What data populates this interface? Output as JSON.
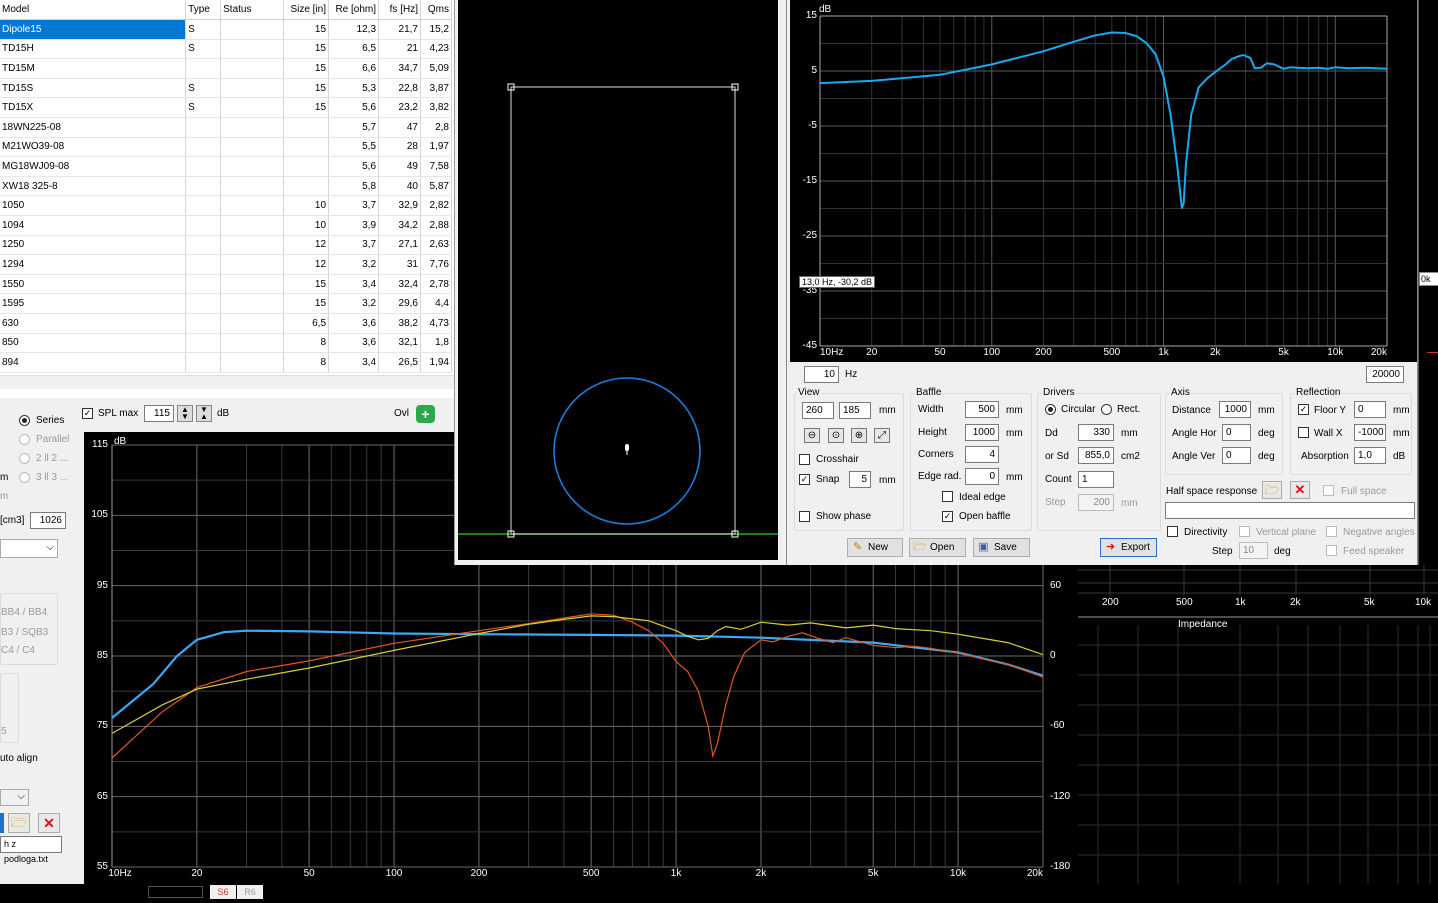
{
  "driver_table": {
    "columns": [
      "Model",
      "Type",
      "Status",
      "Size [in]",
      "Re [ohm]",
      "fs [Hz]",
      "Qms"
    ],
    "rows": [
      [
        "Dipole15",
        "S",
        "",
        "15",
        "12,3",
        "21,7",
        "15,2"
      ],
      [
        "TD15H",
        "S",
        "",
        "15",
        "6,5",
        "21",
        "4,23"
      ],
      [
        "TD15M",
        "",
        "",
        "15",
        "6,6",
        "34,7",
        "5,09"
      ],
      [
        "TD15S",
        "S",
        "",
        "15",
        "5,3",
        "22,8",
        "3,87"
      ],
      [
        "TD15X",
        "S",
        "",
        "15",
        "5,6",
        "23,2",
        "3,82"
      ],
      [
        "18WN225-08",
        "",
        "",
        "",
        "5,7",
        "47",
        "2,8"
      ],
      [
        "M21WO39-08",
        "",
        "",
        "",
        "5,5",
        "28",
        "1,97"
      ],
      [
        "MG18WJ09-08",
        "",
        "",
        "",
        "5,6",
        "49",
        "7,58"
      ],
      [
        "XW18 325-8",
        "",
        "",
        "",
        "5,8",
        "40",
        "5,87"
      ],
      [
        "1050",
        "",
        "",
        "10",
        "3,7",
        "32,9",
        "2,82"
      ],
      [
        "1094",
        "",
        "",
        "10",
        "3,9",
        "34,2",
        "2,88"
      ],
      [
        "1250",
        "",
        "",
        "12",
        "3,7",
        "27,1",
        "2,63"
      ],
      [
        "1294",
        "",
        "",
        "12",
        "3,2",
        "31",
        "7,76"
      ],
      [
        "1550",
        "",
        "",
        "15",
        "3,4",
        "32,4",
        "2,78"
      ],
      [
        "1595",
        "",
        "",
        "15",
        "3,2",
        "29,6",
        "4,4"
      ],
      [
        "630",
        "",
        "",
        "6,5",
        "3,6",
        "38,2",
        "4,73"
      ],
      [
        "850",
        "",
        "",
        "8",
        "3,6",
        "32,1",
        "1,8"
      ],
      [
        "894",
        "",
        "",
        "8",
        "3,4",
        "26,5",
        "1,94"
      ]
    ]
  },
  "left_panel": {
    "series_label": "Series",
    "parallel_label": "Parallel",
    "opt_2p2": "2 ll 2 ...",
    "opt_3p3": "3 ll 3 ...",
    "m_label": "m",
    "m2_label": "m",
    "cm3_label": "[cm3]",
    "cm3_value": "1026",
    "bb_label": "BB4 / BB4",
    "sqb_label": "B3 / SQB3",
    "c4_label": "C4 / C4",
    "num5": "5",
    "auto_align": "uto align",
    "file_name": "h z podloga.txt"
  },
  "spl_toolbar": {
    "spl_max_label": "SPL max",
    "spl_max_value": "115",
    "db_label": "dB",
    "ovl_label": "Ovl"
  },
  "main_chart": {
    "dB_unit": "dB",
    "y_ticks": [
      "115",
      "105",
      "95",
      "85",
      "75",
      "65",
      "55"
    ],
    "right_ticks": [
      "60",
      "0",
      "-60",
      "-120",
      "-180"
    ],
    "x_ticks": [
      "10Hz",
      "20",
      "50",
      "100",
      "200",
      "500",
      "1k",
      "2k",
      "5k",
      "10k",
      "20k"
    ]
  },
  "baffle_response": {
    "dB_unit": "dB",
    "y_ticks": [
      "15",
      "5",
      "-5",
      "-15",
      "-25",
      "-35",
      "-45"
    ],
    "x_ticks": [
      "10Hz",
      "20",
      "50",
      "100",
      "200",
      "500",
      "1k",
      "2k",
      "5k",
      "10k",
      "20k"
    ],
    "cursor_readout": "13,0 Hz, -30,2 dB",
    "freq_min": "10",
    "hz_label": "Hz",
    "freq_max": "20000"
  },
  "baffle_controls": {
    "view": {
      "title": "View",
      "w": "260",
      "h": "185",
      "unit": "mm",
      "crosshair": "Crosshair",
      "snap": "Snap",
      "snap_value": "5",
      "snap_unit": "mm",
      "show_phase": "Show phase"
    },
    "baffle": {
      "title": "Baffle",
      "width_label": "Width",
      "width": "500",
      "height_label": "Height",
      "height": "1000",
      "corners_label": "Corners",
      "corners": "4",
      "edge_label": "Edge rad.",
      "edge": "0",
      "unit": "mm",
      "ideal_edge": "Ideal edge",
      "open_baffle": "Open baffle"
    },
    "drivers": {
      "title": "Drivers",
      "circular": "Circular",
      "rect": "Rect.",
      "dd_label": "Dd",
      "dd": "330",
      "dd_unit": "mm",
      "sd_label": "or Sd",
      "sd": "855,0",
      "sd_unit": "cm2",
      "count_label": "Count",
      "count": "1",
      "step_label": "Step",
      "step": "200",
      "step_unit": "mm"
    },
    "axis": {
      "title": "Axis",
      "distance_label": "Distance",
      "distance": "1000",
      "distance_unit": "mm",
      "hor_label": "Angle Hor",
      "hor": "0",
      "ver_label": "Angle Ver",
      "ver": "0",
      "deg": "deg"
    },
    "reflection": {
      "title": "Reflection",
      "floor": "Floor Y",
      "floor_val": "0",
      "wall": "Wall  X",
      "wall_val": "-1000",
      "mm": "mm",
      "absorption": "Absorption",
      "absorption_val": "1,0",
      "db": "dB"
    },
    "half_space": "Half space response",
    "full_space": "Full space",
    "directivity": "Directivity",
    "vertical_plane": "Vertical plane",
    "negative_angles": "Negative angles",
    "dir_step_label": "Step",
    "dir_step": "10",
    "dir_deg": "deg",
    "feed_speaker": "Feed speaker",
    "btn_new": "New",
    "btn_open": "Open",
    "btn_save": "Save",
    "btn_export": "Export"
  },
  "bg_window": {
    "x_ticks": [
      "200",
      "500",
      "1k",
      "2k",
      "5k",
      "10k"
    ],
    "impedance_title": "Impedance",
    "k_label": "0k"
  },
  "bottom_tabs": [
    "S6",
    "R6"
  ],
  "colors": {
    "blue": "#3ea8f0",
    "red": "#e0561f",
    "yellow": "#d6cf3a",
    "selection": "#0078d7",
    "baffle_curve": "#18aaf0",
    "speaker_circle": "#1a7fd6",
    "floor_line": "#22aa22"
  }
}
